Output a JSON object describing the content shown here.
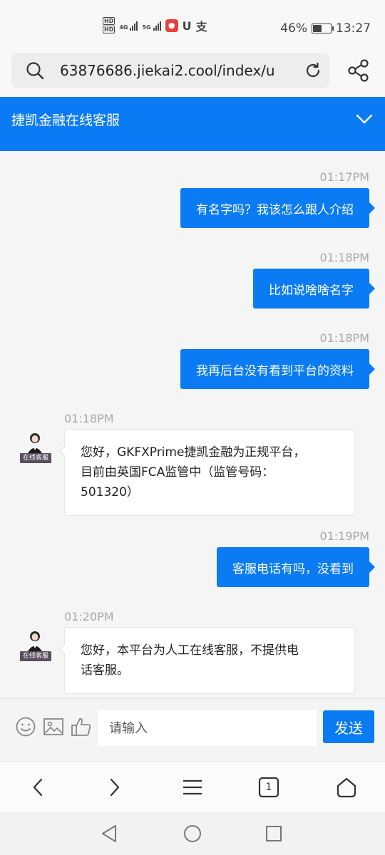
{
  "status_bar": {
    "battery_text": "46%",
    "battery_level": 0.46,
    "time": "13:27",
    "hd_badge_top": "HD",
    "hd_badge_bottom": "HD",
    "network_1": "4G",
    "network_2": "5G",
    "app_icon_1": "weibo-icon",
    "app_glyph_1": "U",
    "app_glyph_2": "支"
  },
  "browser": {
    "url": "63876686.jiekai2.cool/index/u",
    "icons": {
      "search": "search-icon",
      "reload": "reload-icon",
      "share": "share-icon"
    }
  },
  "chat": {
    "title": "捷凯金融在线客服",
    "agent_badge": "在线客服",
    "messages": [
      {
        "from": "user",
        "time": "01:17PM",
        "text": "有名字吗？我该怎么跟人介绍"
      },
      {
        "from": "user",
        "time": "01:18PM",
        "text": "比如说啥啥名字"
      },
      {
        "from": "user",
        "time": "01:18PM",
        "text": "我再后台没有看到平台的资料"
      },
      {
        "from": "agent",
        "time": "01:18PM",
        "lines": [
          "您好，GKFXPrime捷凯金融为正规平台，",
          "目前由英国FCA监管中（监管号码：",
          "501320）"
        ]
      },
      {
        "from": "user",
        "time": "01:19PM",
        "text": "客服电话有吗，没看到"
      },
      {
        "from": "agent",
        "time": "01:20PM",
        "lines": [
          "您好，本平台为人工在线客服，不提供电",
          "话客服。"
        ]
      }
    ]
  },
  "input": {
    "placeholder": "请输入",
    "send_label": "发送",
    "icons": [
      "emoji-icon",
      "image-icon",
      "thumbs-up-icon"
    ]
  },
  "browser_nav": {
    "tab_count": "1"
  },
  "colors": {
    "accent": "#0b7bf4",
    "background": "#f5f5f5",
    "timestamp": "#a8a8a8"
  }
}
